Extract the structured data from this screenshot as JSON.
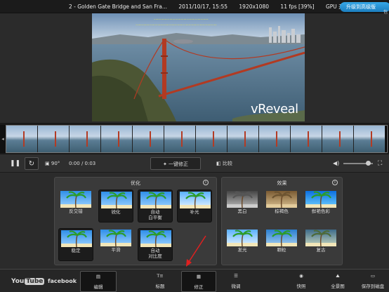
{
  "topbar": {
    "file_title": "2 - Golden Gate Bridge and San Fra...",
    "datetime": "2011/10/17, 15:55",
    "resolution": "1920x1080",
    "fps": "11 fps [39%]",
    "gpu": "GPU 开启",
    "upgrade_label": "升级到高级版",
    "upgrade_sub": "包"
  },
  "video": {
    "overlay_line1": "...................................",
    "overlay_line2": "....................................................",
    "brand": "vReveal"
  },
  "controls": {
    "rotate_label": "90°",
    "time": "0:00 / 0:03",
    "one_click_fix": "一键修正",
    "compare": "比较",
    "volume_level": 0.85
  },
  "fix_panel": {
    "title": "优化",
    "tiles": [
      {
        "label": "反交错",
        "selected": false
      },
      {
        "label": "锐化",
        "selected": true
      },
      {
        "label": "自动\n白平衡",
        "selected": true
      },
      {
        "label": "补光",
        "selected": true
      },
      {
        "label": "稳定",
        "selected": true
      },
      {
        "label": "平滑",
        "selected": false
      },
      {
        "label": "自动\n对比度",
        "selected": true
      }
    ]
  },
  "effects_panel": {
    "title": "效果",
    "tiles": [
      {
        "label": "黑白"
      },
      {
        "label": "棕褐色"
      },
      {
        "label": "鲜艳色彩"
      },
      {
        "label": "发光"
      },
      {
        "label": "颗粒"
      },
      {
        "label": "复古"
      }
    ]
  },
  "bottombar": {
    "youtube_a": "You",
    "youtube_b": "Tube",
    "facebook": "facebook",
    "items": [
      "编辑",
      "标题",
      "修正",
      "微调",
      "快照",
      "全景图",
      "保存到磁盘"
    ]
  },
  "colors": {
    "accent": "#2a8ad0",
    "arrow": "#e02020",
    "bridge": "#b23a22"
  }
}
